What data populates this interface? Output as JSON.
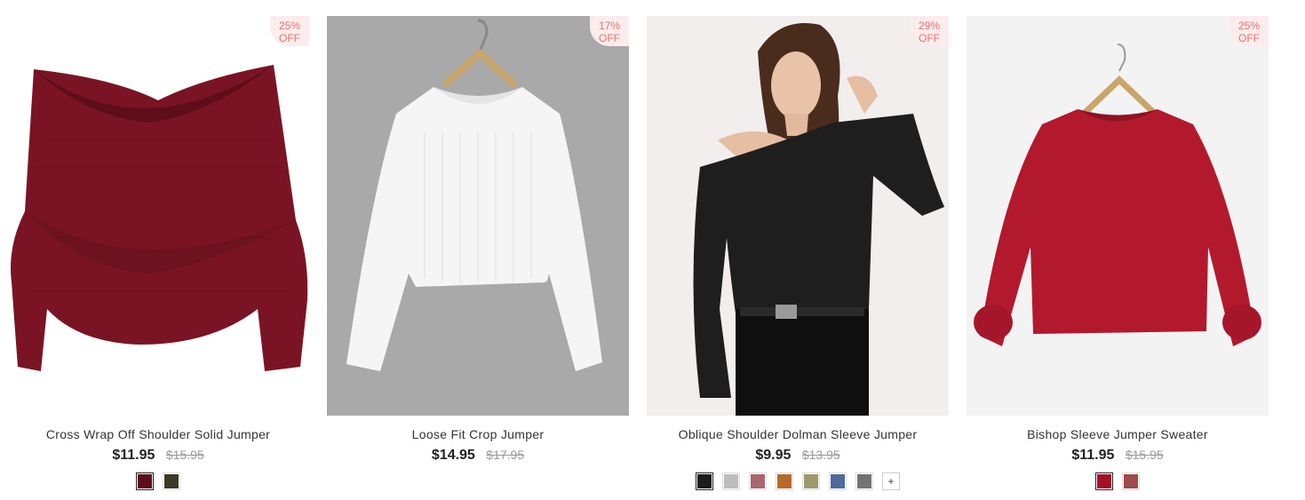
{
  "products": [
    {
      "title": "Cross Wrap Off Shoulder Solid Jumper",
      "price": "$11.95",
      "old_price": "$15.95",
      "discount_pct": "25%",
      "discount_off": "OFF",
      "image": "burgundy-wrap-jumper-image",
      "swatches": [
        "#5a0f1a",
        "#3b3a24"
      ],
      "selected_swatch": 0
    },
    {
      "title": "Loose Fit Crop Jumper",
      "price": "$14.95",
      "old_price": "$17.95",
      "discount_pct": "17%",
      "discount_off": "OFF",
      "image": "white-crop-jumper-image",
      "swatches": [],
      "selected_swatch": -1
    },
    {
      "title": "Oblique Shoulder Dolman Sleeve Jumper",
      "price": "$9.95",
      "old_price": "$13.95",
      "discount_pct": "29%",
      "discount_off": "OFF",
      "image": "black-dolman-jumper-model-image",
      "swatches": [
        "#1c1c1c",
        "#bdbdbd",
        "#a8686e",
        "#b56a2a",
        "#9c9a6a",
        "#4e6a99",
        "#737373"
      ],
      "selected_swatch": 0,
      "more_label": "+"
    },
    {
      "title": "Bishop Sleeve Jumper Sweater",
      "price": "$11.95",
      "old_price": "$15.95",
      "discount_pct": "25%",
      "discount_off": "OFF",
      "image": "red-bishop-sleeve-sweater-image",
      "swatches": [
        "#a11226",
        "#9e4a4f"
      ],
      "selected_swatch": 0
    }
  ]
}
